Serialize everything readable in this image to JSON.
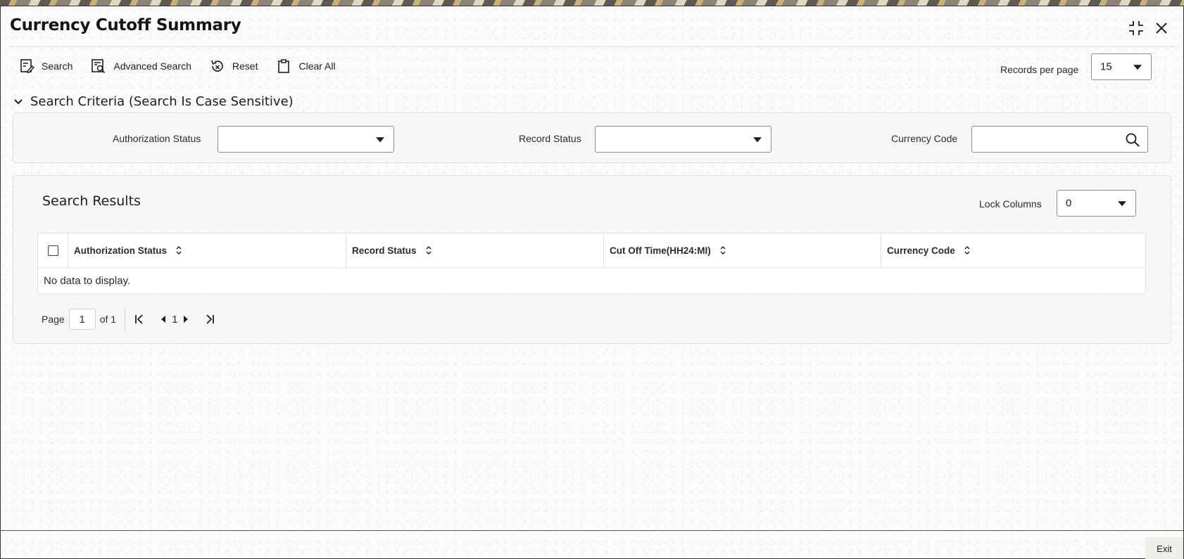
{
  "window": {
    "title": "Currency Cutoff Summary"
  },
  "toolbar": {
    "search_label": "Search",
    "advanced_search_label": "Advanced Search",
    "reset_label": "Reset",
    "clear_all_label": "Clear All"
  },
  "records_per_page": {
    "label": "Records per page",
    "value": "15"
  },
  "search_criteria": {
    "heading": "Search Criteria (Search Is Case Sensitive)",
    "authorization_status_label": "Authorization Status",
    "authorization_status_value": "",
    "record_status_label": "Record Status",
    "record_status_value": "",
    "currency_code_label": "Currency Code",
    "currency_code_value": ""
  },
  "results": {
    "title": "Search Results",
    "lock_columns_label": "Lock Columns",
    "lock_columns_value": "0",
    "columns": [
      "Authorization Status",
      "Record Status",
      "Cut Off Time(HH24:MI)",
      "Currency Code"
    ],
    "empty_message": "No data to display."
  },
  "pagination": {
    "page_label": "Page",
    "current_page": "1",
    "of_label": "of 1",
    "page_number": "1"
  },
  "footer": {
    "exit_label": "Exit"
  }
}
